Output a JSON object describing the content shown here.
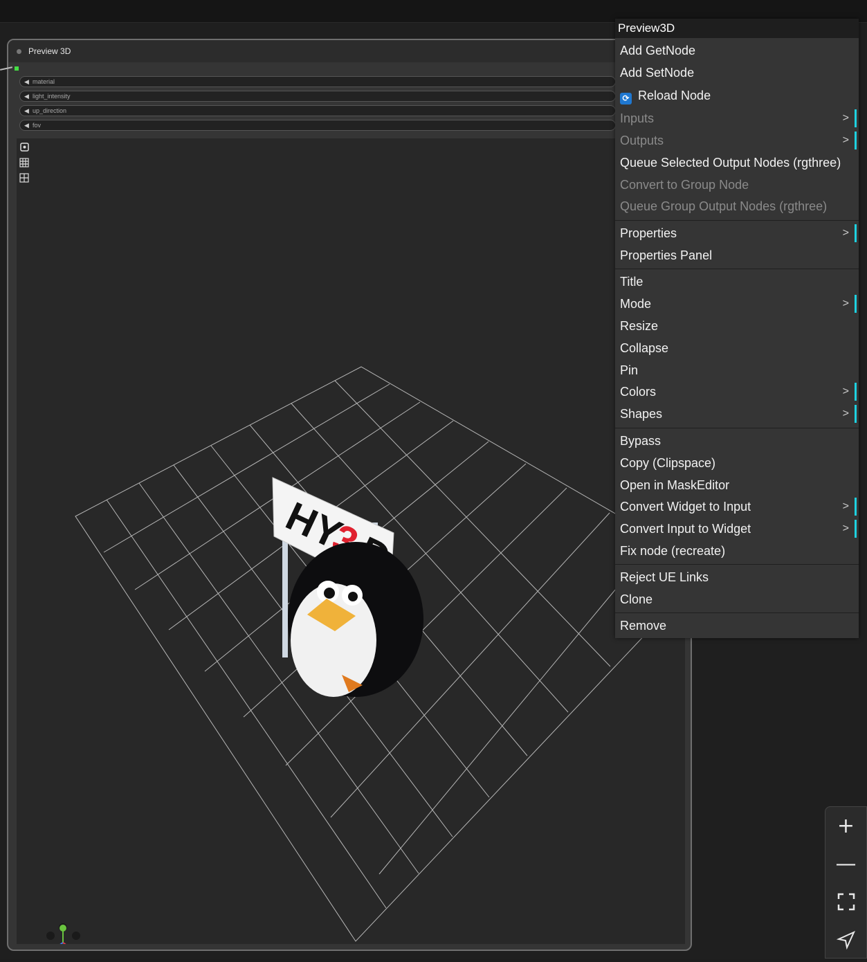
{
  "node": {
    "title": "Preview 3D",
    "widgets": [
      {
        "label": "material"
      },
      {
        "label": "light_intensity"
      },
      {
        "label": "up_direction"
      },
      {
        "label": "fov"
      }
    ]
  },
  "viewport": {
    "sign_text_1": "HY",
    "sign_text_2": "3",
    "sign_text_3": "D",
    "tools": [
      "camera-icon",
      "grid-icon",
      "layout-icon"
    ]
  },
  "menu": {
    "title": "Preview3D",
    "items": [
      {
        "label": "Add GetNode"
      },
      {
        "label": "Add SetNode"
      },
      {
        "label": "Reload Node"
      },
      {
        "label": "Inputs"
      },
      {
        "label": "Outputs"
      },
      {
        "label": "Queue Selected Output Nodes (rgthree)"
      },
      {
        "label": "Convert to Group Node"
      },
      {
        "label": "Queue Group Output Nodes (rgthree)"
      },
      {
        "label": "Properties"
      },
      {
        "label": "Properties Panel"
      },
      {
        "label": "Title"
      },
      {
        "label": "Mode"
      },
      {
        "label": "Resize"
      },
      {
        "label": "Collapse"
      },
      {
        "label": "Pin"
      },
      {
        "label": "Colors"
      },
      {
        "label": "Shapes"
      },
      {
        "label": "Bypass"
      },
      {
        "label": "Copy (Clipspace)"
      },
      {
        "label": "Open in MaskEditor"
      },
      {
        "label": "Convert Widget to Input"
      },
      {
        "label": "Convert Input to Widget"
      },
      {
        "label": "Fix node (recreate)"
      },
      {
        "label": "Reject UE Links"
      },
      {
        "label": "Clone"
      },
      {
        "label": "Remove"
      }
    ],
    "submenu_glyph": ">"
  },
  "zoom_controls": {
    "zoom_in": "+",
    "zoom_out": "—"
  },
  "colors": {
    "accent_cyan": "#1ed1e0",
    "slot_green": "#44dd44",
    "reload_blue": "#1f78d1"
  }
}
